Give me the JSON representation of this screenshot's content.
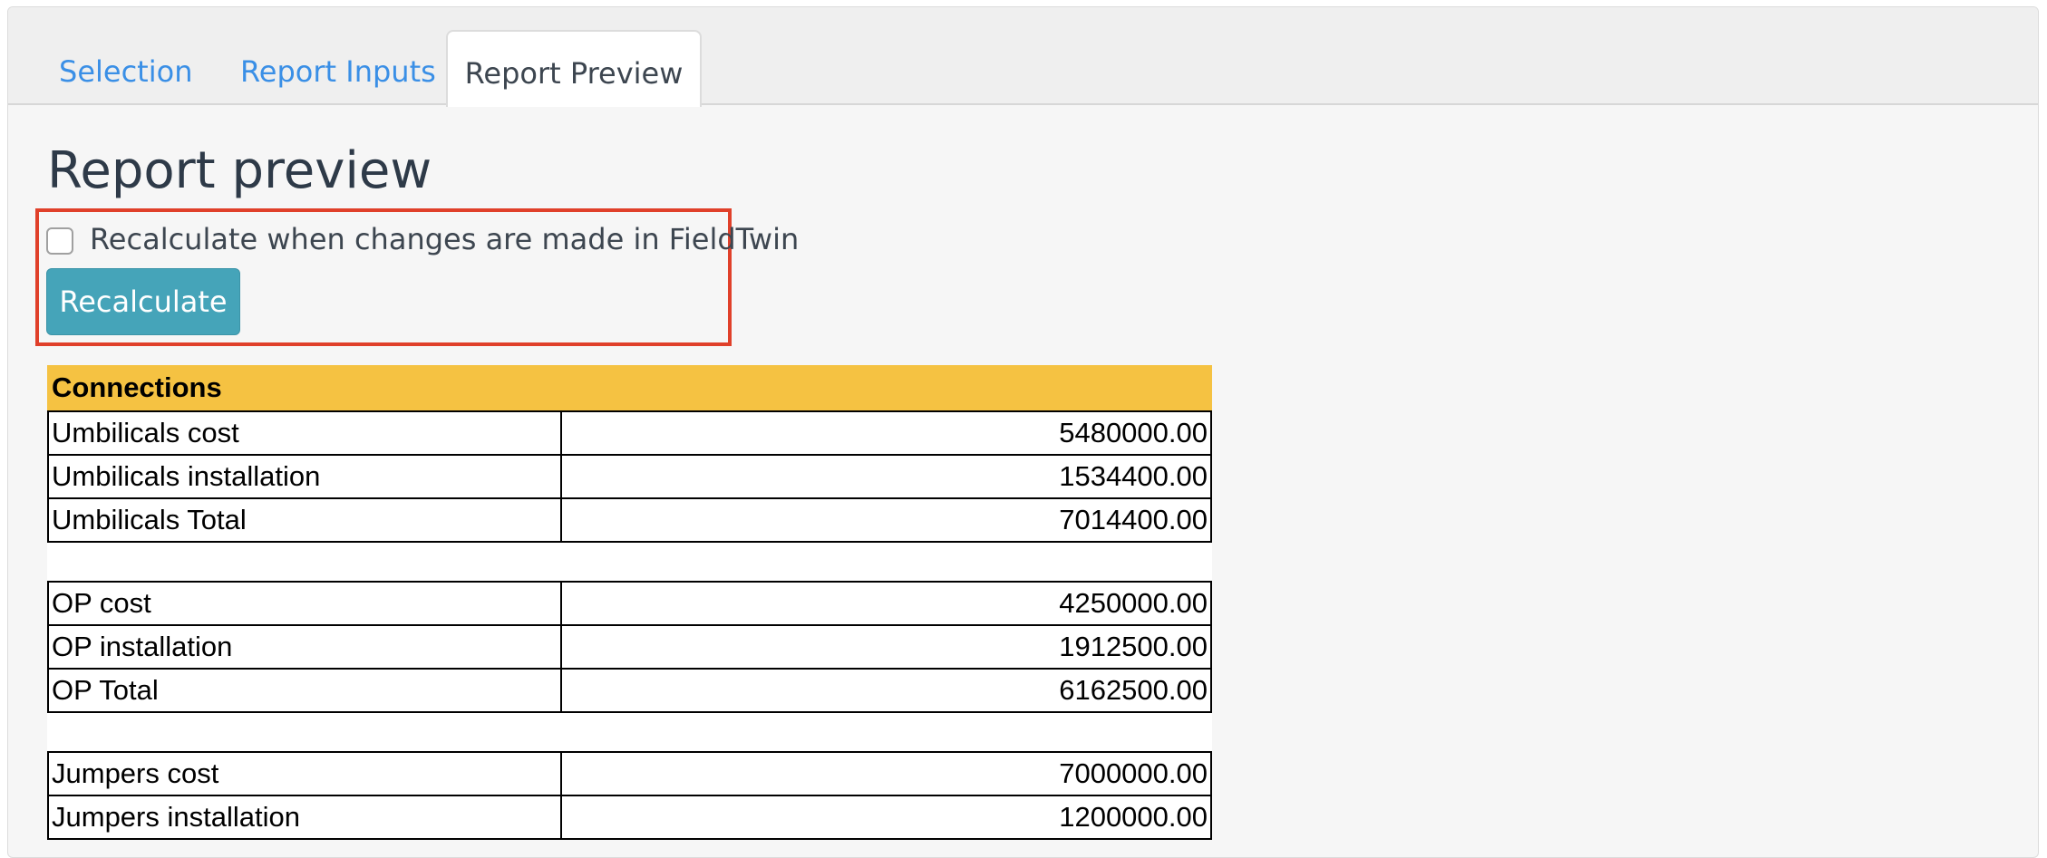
{
  "tabs": [
    {
      "label": "Selection"
    },
    {
      "label": "Report Inputs"
    },
    {
      "label": "Report Preview",
      "active": true
    }
  ],
  "page_title": "Report preview",
  "recalc_checkbox": {
    "label": "Recalculate when changes are made in FieldTwin",
    "checked": false
  },
  "recalc_button": {
    "label": "Recalculate"
  },
  "report": {
    "section_title": "Connections",
    "groups": [
      {
        "rows": [
          {
            "label": "Umbilicals cost",
            "value": "5480000.00"
          },
          {
            "label": "Umbilicals installation",
            "value": "1534400.00"
          },
          {
            "label": "Umbilicals Total",
            "value": "7014400.00"
          }
        ]
      },
      {
        "rows": [
          {
            "label": "OP cost",
            "value": "4250000.00"
          },
          {
            "label": "OP installation",
            "value": "1912500.00"
          },
          {
            "label": "OP Total",
            "value": "6162500.00"
          }
        ]
      },
      {
        "rows": [
          {
            "label": "Jumpers cost",
            "value": "7000000.00"
          },
          {
            "label": "Jumpers installation",
            "value": "1200000.00"
          }
        ]
      }
    ]
  },
  "colors": {
    "tab_link": "#3a8fe6",
    "section_header_bg": "#f5c242",
    "button_bg": "#45a4b9",
    "highlight_border": "#e0402a"
  }
}
